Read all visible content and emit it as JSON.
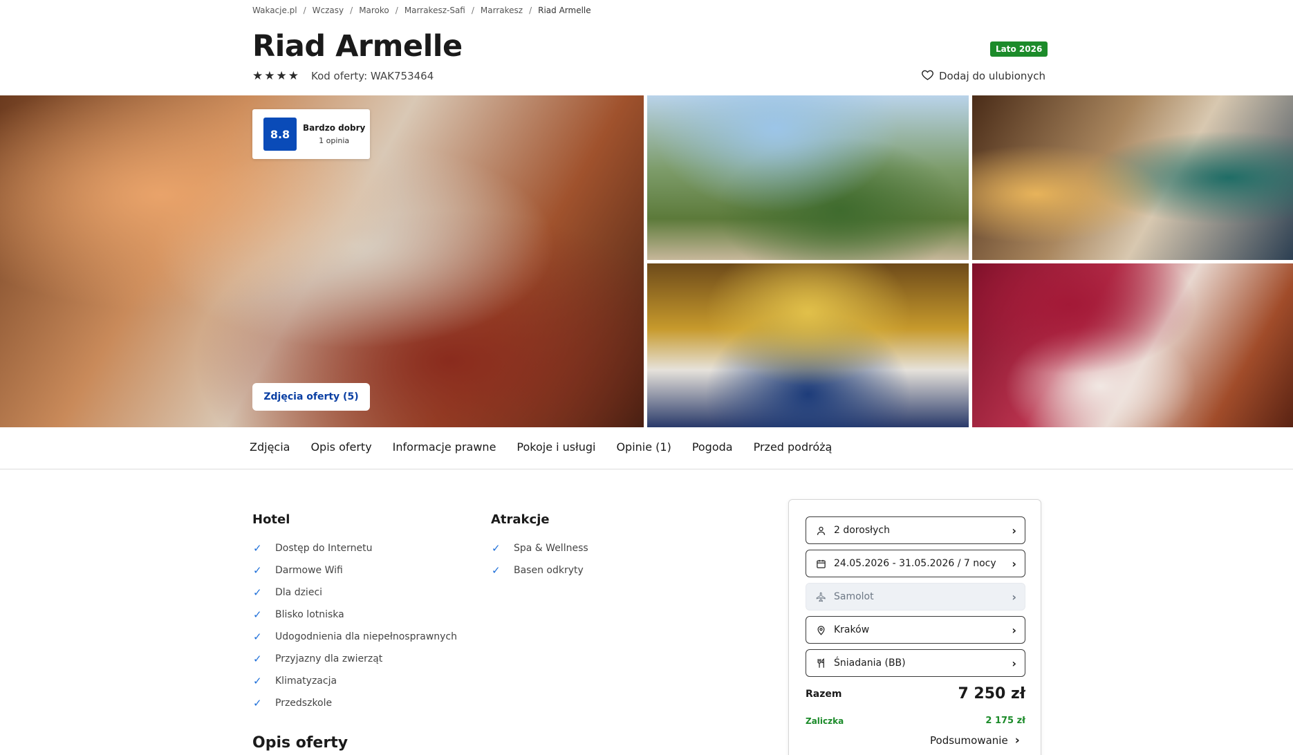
{
  "breadcrumb": [
    "Wakacje.pl",
    "Wczasy",
    "Maroko",
    "Marrakesz-Safi",
    "Marrakesz",
    "Riad Armelle"
  ],
  "breadcrumb_separator": "/",
  "hotel": {
    "name": "Riad Armelle",
    "stars": 4,
    "offer_code": "Kod oferty: WAK753464",
    "season_badge": "Lato 2026",
    "favorite_label": "Dodaj do ulubionych"
  },
  "rating": {
    "score": "8.8",
    "label": "Bardzo dobry",
    "count": "1 opinia"
  },
  "gallery": {
    "photos_button": "Zdjęcia oferty (5)"
  },
  "tabs": [
    "Zdjęcia",
    "Opis oferty",
    "Informacje prawne",
    "Pokoje i usługi",
    "Opinie (1)",
    "Pogoda",
    "Przed podróżą"
  ],
  "amenities": {
    "hotel": {
      "title": "Hotel",
      "items": [
        "Dostęp do Internetu",
        "Darmowe Wifi",
        "Dla dzieci",
        "Blisko lotniska",
        "Udogodnienia dla niepełnosprawnych",
        "Przyjazny dla zwierząt",
        "Klimatyzacja",
        "Przedszkole"
      ]
    },
    "attractions": {
      "title": "Atrakcje",
      "items": [
        "Spa & Wellness",
        "Basen odkryty"
      ]
    }
  },
  "description_heading": "Opis oferty",
  "booking": {
    "travelers": "2 dorosłych",
    "dates": "24.05.2026 - 31.05.2026 / 7 nocy",
    "transport": "Samolot",
    "departure": "Kraków",
    "board": "Śniadania (BB)",
    "total_label": "Razem",
    "total_value": "7 250 zł",
    "deposit_label": "Zaliczka",
    "deposit_value": "2 175 zł",
    "summary_link": "Podsumowanie"
  },
  "colors": {
    "accent_blue": "#0a4bb8",
    "badge_green": "#1c8b2a",
    "check_blue": "#1e6fd9"
  }
}
